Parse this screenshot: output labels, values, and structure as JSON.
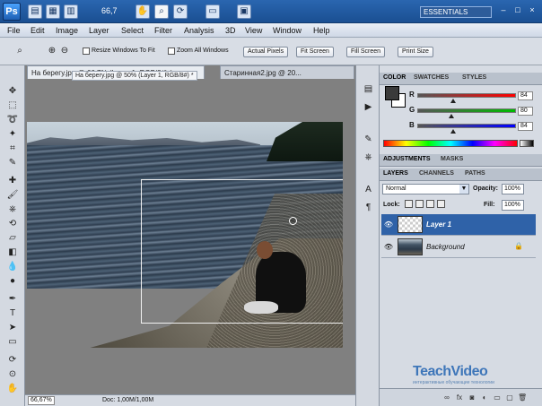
{
  "appbar": {
    "logo": "Ps",
    "zoom": "66,7",
    "workspace": "ESSENTIALS",
    "window_controls": [
      "–",
      "□",
      "×"
    ]
  },
  "menu": [
    "File",
    "Edit",
    "Image",
    "Layer",
    "Select",
    "Filter",
    "Analysis",
    "3D",
    "View",
    "Window",
    "Help"
  ],
  "options": {
    "resize_windows": "Resize Windows To Fit",
    "zoom_all_windows": "Zoom All Windows",
    "actual_pixels": "Actual Pixels",
    "fit_screen": "Fit Screen",
    "fill_screen": "Fill Screen",
    "print_size": "Print Size"
  },
  "documents": {
    "active_tab": "На берегу.jpg @ 66,7% (Layer 1, RGB/8#) *",
    "floating_tab": "На берегу.jpg @ 50% (Layer 1, RGB/8#) *",
    "second_tab": "Старинная2.jpg @ 20..."
  },
  "status": {
    "zoom": "66,67%",
    "doc": "Doc: 1,00M/1,00M"
  },
  "color_panel": {
    "tabs": [
      "COLOR",
      "SWATCHES",
      "STYLES"
    ],
    "channels": [
      {
        "label": "R",
        "value": "84",
        "color": "#ff0000",
        "position": 0.33
      },
      {
        "label": "G",
        "value": "80",
        "color": "#00b000",
        "position": 0.31
      },
      {
        "label": "B",
        "value": "84",
        "color": "#0000ff",
        "position": 0.33
      }
    ]
  },
  "adjust_tabs": [
    "ADJUSTMENTS",
    "MASKS"
  ],
  "layers_panel": {
    "tabs": [
      "LAYERS",
      "CHANNELS",
      "PATHS"
    ],
    "blend_mode": "Normal",
    "opacity_label": "Opacity:",
    "opacity": "100%",
    "lock_label": "Lock:",
    "fill_label": "Fill:",
    "fill": "100%",
    "layers": [
      {
        "name": "Layer 1",
        "selected": true
      },
      {
        "name": "Background",
        "selected": false,
        "locked": true
      }
    ]
  },
  "watermark": {
    "title": "TeachVideo",
    "subtitle": "интерактивные обучающие технологии"
  }
}
